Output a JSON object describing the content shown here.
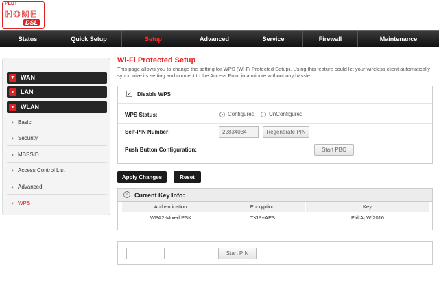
{
  "logo": {
    "brand": "PLDT",
    "home": "HOME",
    "dsl": "DSL"
  },
  "nav": {
    "items": [
      {
        "label": "Status"
      },
      {
        "label": "Quick Setup"
      },
      {
        "label": "Setup"
      },
      {
        "label": "Advanced"
      },
      {
        "label": "Service"
      },
      {
        "label": "Firewall"
      },
      {
        "label": "Maintenance"
      }
    ],
    "active": "Setup"
  },
  "sidebar": {
    "groups": [
      {
        "label": "WAN"
      },
      {
        "label": "LAN"
      },
      {
        "label": "WLAN"
      }
    ],
    "items": [
      {
        "label": "Basic"
      },
      {
        "label": "Security"
      },
      {
        "label": "MBSSID"
      },
      {
        "label": "Access Control List"
      },
      {
        "label": "Advanced"
      },
      {
        "label": "WPS"
      }
    ],
    "active_item": "WPS"
  },
  "page": {
    "title": "Wi-Fi Protected Setup",
    "description": "This page allows you to change the setting for WPS (Wi-Fi Protected Setup). Using this feature could let your wireless client automatically syncronize its setting and connect to the Access Point in a minute without any hassle."
  },
  "wps": {
    "disable_label": "Disable WPS",
    "disable_checked": true,
    "status_label": "WPS Status:",
    "status_options": [
      "Configured",
      "UnConfigured"
    ],
    "status_selected": "Configured",
    "self_pin_label": "Self-PIN Number:",
    "self_pin_value": "22834034",
    "regenerate_label": "Regenerate PIN",
    "push_button_label": "Push Button Configuration:",
    "start_pbc_label": "Start PBC"
  },
  "actions": {
    "apply_label": "Apply Changes",
    "reset_label": "Reset"
  },
  "key_info": {
    "title": "Current Key Info:",
    "headers": [
      "Authentication",
      "Encryption",
      "Key"
    ],
    "row": [
      "WPA2-Mixed PSK",
      "TKIP+AES",
      "PldtApWf2016"
    ]
  },
  "pin": {
    "input_value": "",
    "start_pin_label": "Start PIN"
  },
  "colors": {
    "accent": "#dd2222",
    "nav_bg": "#1a1a1a"
  }
}
